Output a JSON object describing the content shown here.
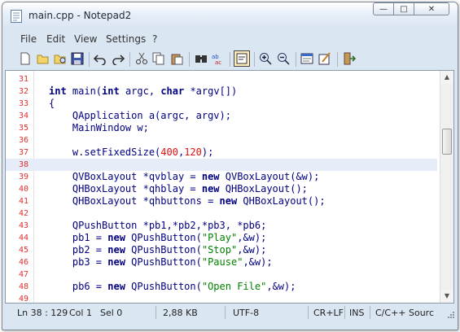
{
  "window": {
    "title": "main.cpp - Notepad2",
    "controls": [
      "minimize-icon",
      "maximize-icon",
      "close-icon"
    ]
  },
  "menu": [
    "File",
    "Edit",
    "View",
    "Settings",
    "?"
  ],
  "toolbar": [
    "new-file-icon",
    "open-folder-icon",
    "browse-icon",
    "save-icon",
    "undo-icon",
    "redo-icon",
    "cut-icon",
    "copy-icon",
    "paste-icon",
    "find-icon",
    "replace-icon",
    "word-wrap-icon",
    "zoom-in-icon",
    "zoom-out-icon",
    "scheme-icon",
    "customize-schemes-icon",
    "exit-icon"
  ],
  "editor": {
    "current_line": 38,
    "lines": [
      {
        "n": "31",
        "tokens": []
      },
      {
        "n": "32",
        "tokens": [
          {
            "t": "int",
            "c": "kw"
          },
          {
            "t": " main(",
            "c": ""
          },
          {
            "t": "int",
            "c": "kw"
          },
          {
            "t": " argc, ",
            "c": ""
          },
          {
            "t": "char",
            "c": "kw"
          },
          {
            "t": " *argv[])",
            "c": ""
          }
        ]
      },
      {
        "n": "33",
        "tokens": [
          {
            "t": "{",
            "c": ""
          }
        ]
      },
      {
        "n": "34",
        "tokens": [
          {
            "t": "    QApplication a(argc, argv);",
            "c": ""
          }
        ]
      },
      {
        "n": "35",
        "tokens": [
          {
            "t": "    MainWindow w;",
            "c": ""
          }
        ]
      },
      {
        "n": "36",
        "tokens": []
      },
      {
        "n": "37",
        "tokens": [
          {
            "t": "    w.setFixedSize(",
            "c": ""
          },
          {
            "t": "400",
            "c": "num"
          },
          {
            "t": ",",
            "c": ""
          },
          {
            "t": "120",
            "c": "num"
          },
          {
            "t": ");",
            "c": ""
          }
        ]
      },
      {
        "n": "38",
        "tokens": []
      },
      {
        "n": "39",
        "tokens": [
          {
            "t": "    QVBoxLayout *qvblay = ",
            "c": ""
          },
          {
            "t": "new",
            "c": "kw"
          },
          {
            "t": " QVBoxLayout(&w);",
            "c": ""
          }
        ]
      },
      {
        "n": "40",
        "tokens": [
          {
            "t": "    QHBoxLayout *qhblay = ",
            "c": ""
          },
          {
            "t": "new",
            "c": "kw"
          },
          {
            "t": " QHBoxLayout();",
            "c": ""
          }
        ]
      },
      {
        "n": "41",
        "tokens": [
          {
            "t": "    QHBoxLayout *qhbuttons = ",
            "c": ""
          },
          {
            "t": "new",
            "c": "kw"
          },
          {
            "t": " QHBoxLayout();",
            "c": ""
          }
        ]
      },
      {
        "n": "42",
        "tokens": []
      },
      {
        "n": "43",
        "tokens": [
          {
            "t": "    QPushButton *pb1,*pb2,*pb3, *pb6;",
            "c": ""
          }
        ]
      },
      {
        "n": "44",
        "tokens": [
          {
            "t": "    pb1 = ",
            "c": ""
          },
          {
            "t": "new",
            "c": "kw"
          },
          {
            "t": " QPushButton(",
            "c": ""
          },
          {
            "t": "\"Play\"",
            "c": "str"
          },
          {
            "t": ",&w);",
            "c": ""
          }
        ]
      },
      {
        "n": "45",
        "tokens": [
          {
            "t": "    pb2 = ",
            "c": ""
          },
          {
            "t": "new",
            "c": "kw"
          },
          {
            "t": " QPushButton(",
            "c": ""
          },
          {
            "t": "\"Stop\"",
            "c": "str"
          },
          {
            "t": ",&w);",
            "c": ""
          }
        ]
      },
      {
        "n": "46",
        "tokens": [
          {
            "t": "    pb3 = ",
            "c": ""
          },
          {
            "t": "new",
            "c": "kw"
          },
          {
            "t": " QPushButton(",
            "c": ""
          },
          {
            "t": "\"Pause\"",
            "c": "str"
          },
          {
            "t": ",&w);",
            "c": ""
          }
        ]
      },
      {
        "n": "47",
        "tokens": []
      },
      {
        "n": "48",
        "tokens": [
          {
            "t": "    pb6 = ",
            "c": ""
          },
          {
            "t": "new",
            "c": "kw"
          },
          {
            "t": " QPushButton(",
            "c": ""
          },
          {
            "t": "\"Open File\"",
            "c": "str"
          },
          {
            "t": ",&w);",
            "c": ""
          }
        ]
      },
      {
        "n": "49",
        "tokens": []
      }
    ]
  },
  "status": {
    "position": "Ln 38 : 129",
    "col": "Col 1",
    "sel": "Sel 0",
    "size": "2,88 KB",
    "encoding": "UTF-8",
    "eol": "CR+LF",
    "mode": "INS",
    "lexer": "C/C++ Sourc"
  },
  "colors": {
    "keyword": "#000080",
    "number": "#e01010",
    "string": "#008000",
    "line_number": "#e03030",
    "current_line": "#e6edf9"
  }
}
